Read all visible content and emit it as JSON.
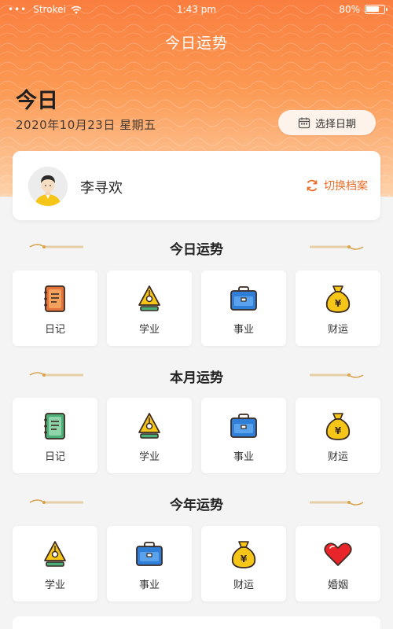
{
  "status_bar": {
    "dots": "•••",
    "carrier": "Strokei",
    "time": "1:43 pm",
    "battery": "80%",
    "battery_level": 0.8
  },
  "nav": {
    "title": "今日运势"
  },
  "header": {
    "today": "今日",
    "date": "2020年10月23日 星期五",
    "select_date_label": "选择日期"
  },
  "profile": {
    "name": "李寻欢",
    "switch_label": "切换档案"
  },
  "sections": [
    {
      "title": "今日运势",
      "items": [
        {
          "label": "日记",
          "icon": "diary-icon"
        },
        {
          "label": "学业",
          "icon": "study-icon"
        },
        {
          "label": "事业",
          "icon": "career-icon"
        },
        {
          "label": "财运",
          "icon": "money-bag-icon"
        }
      ]
    },
    {
      "title": "本月运势",
      "items": [
        {
          "label": "日记",
          "icon": "diary-icon"
        },
        {
          "label": "学业",
          "icon": "study-icon"
        },
        {
          "label": "事业",
          "icon": "career-icon"
        },
        {
          "label": "财运",
          "icon": "money-bag-icon"
        }
      ]
    },
    {
      "title": "今年运势",
      "items": [
        {
          "label": "学业",
          "icon": "study-icon"
        },
        {
          "label": "事业",
          "icon": "career-icon"
        },
        {
          "label": "财运",
          "icon": "money-bag-icon"
        },
        {
          "label": "婚姻",
          "icon": "heart-icon"
        }
      ]
    }
  ],
  "colors": {
    "accent": "#f97e3f",
    "switch": "#e86e2a"
  }
}
